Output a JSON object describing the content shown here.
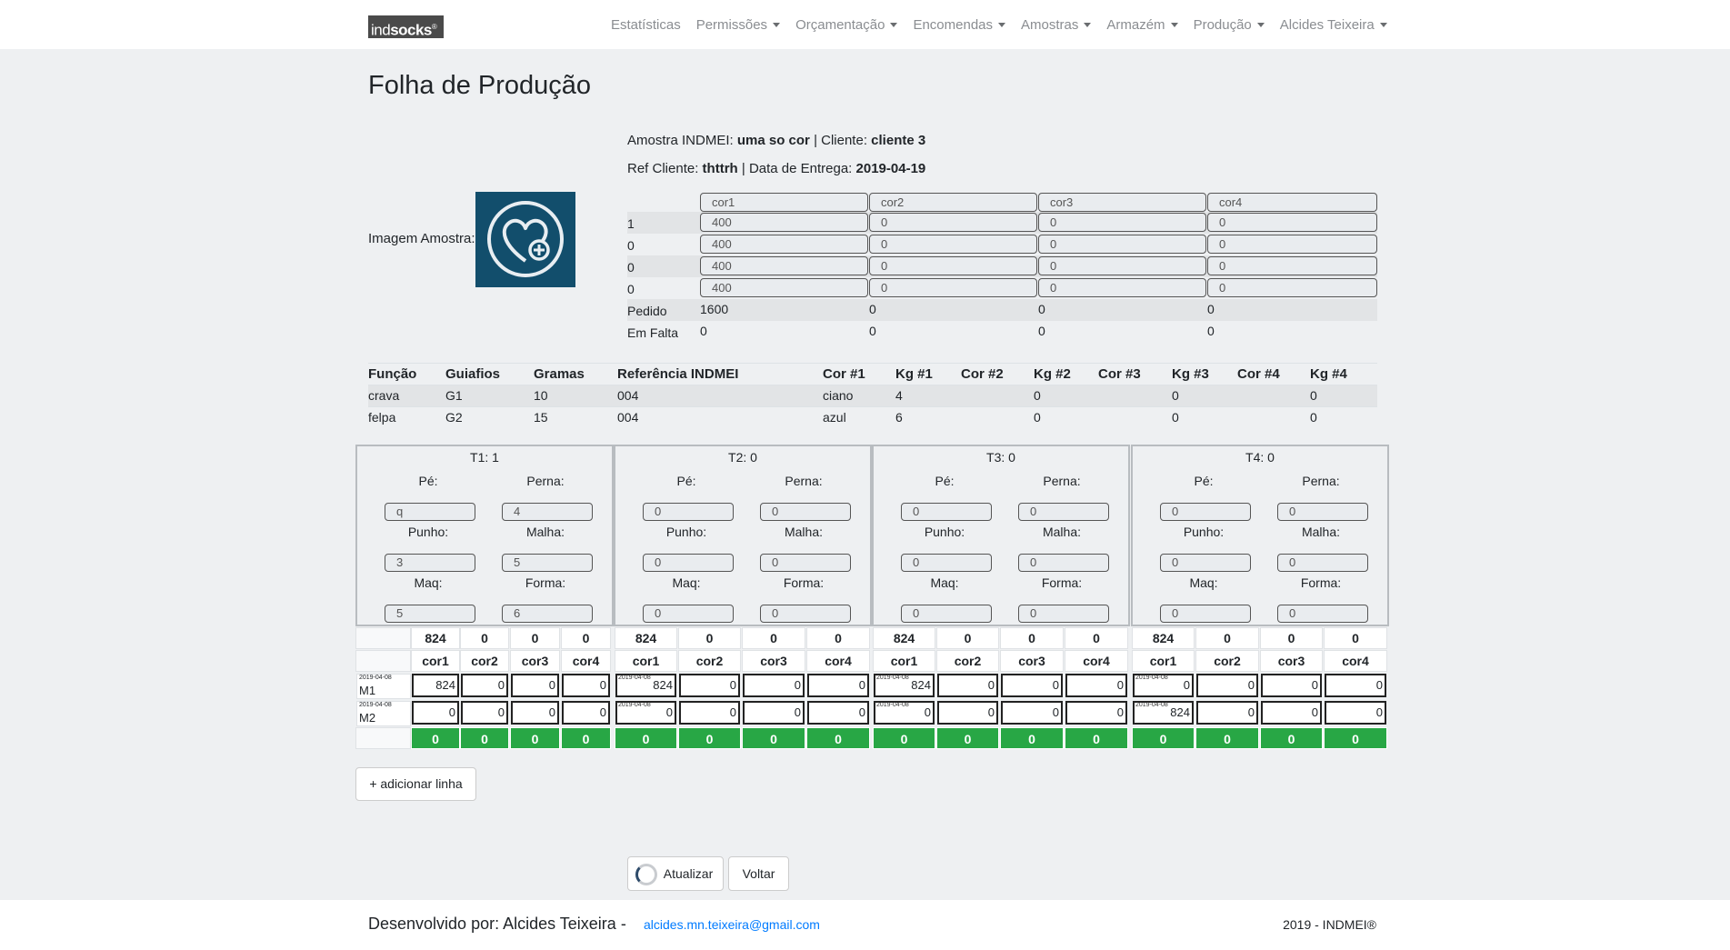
{
  "brand": {
    "prefix": "ind",
    "bold": "socks",
    "mark": "®"
  },
  "nav": {
    "items": [
      {
        "label": "Estatísticas",
        "dropdown": false
      },
      {
        "label": "Permissões",
        "dropdown": true
      },
      {
        "label": "Orçamentação",
        "dropdown": true
      },
      {
        "label": "Encomendas",
        "dropdown": true
      },
      {
        "label": "Amostras",
        "dropdown": true
      },
      {
        "label": "Armazém",
        "dropdown": true
      },
      {
        "label": "Produção",
        "dropdown": true
      },
      {
        "label": "Alcides Teixeira",
        "dropdown": true
      }
    ]
  },
  "page": {
    "title": "Folha de Produção"
  },
  "sample": {
    "amostra_label": "Amostra INDMEI:",
    "amostra_value": "uma so cor",
    "cliente_label": "| Cliente:",
    "cliente_value": "cliente 3",
    "ref_label": "Ref Cliente:",
    "ref_value": "thttrh",
    "data_label": "| Data de Entrega:",
    "data_value": "2019-04-19",
    "image_label": "Imagem Amostra:",
    "image_icon": "heart-plus-icon"
  },
  "colors_table": {
    "headers": [
      "cor1",
      "cor2",
      "cor3",
      "cor4"
    ],
    "rows": [
      {
        "label": "1",
        "values": [
          "400",
          "0",
          "0",
          "0"
        ]
      },
      {
        "label": "0",
        "values": [
          "400",
          "0",
          "0",
          "0"
        ]
      },
      {
        "label": "0",
        "values": [
          "400",
          "0",
          "0",
          "0"
        ]
      },
      {
        "label": "0",
        "values": [
          "400",
          "0",
          "0",
          "0"
        ]
      }
    ],
    "pedido": {
      "label": "Pedido",
      "values": [
        "1600",
        "0",
        "0",
        "0"
      ]
    },
    "em_falta": {
      "label": "Em Falta",
      "values": [
        "0",
        "0",
        "0",
        "0"
      ]
    }
  },
  "function_table": {
    "headers": [
      "Função",
      "Guiafios",
      "Gramas",
      "Referência INDMEI",
      "Cor #1",
      "Kg #1",
      "Cor #2",
      "Kg #2",
      "Cor #3",
      "Kg #3",
      "Cor #4",
      "Kg #4"
    ],
    "rows": [
      [
        "crava",
        "G1",
        "10",
        "004",
        "ciano",
        "4",
        "",
        "0",
        "",
        "0",
        "",
        "0"
      ],
      [
        "felpa",
        "G2",
        "15",
        "004",
        "azul",
        "6",
        "",
        "0",
        "",
        "0",
        "",
        "0"
      ]
    ]
  },
  "panels": {
    "labels": {
      "pe": "Pé:",
      "perna": "Perna:",
      "punho": "Punho:",
      "malha": "Malha:",
      "maq": "Maq:",
      "forma": "Forma:"
    },
    "items": [
      {
        "title": "T1: 1",
        "pe": "q",
        "perna": "4",
        "punho": "3",
        "malha": "5",
        "maq": "5",
        "forma": "6"
      },
      {
        "title": "T2: 0",
        "pe": "0",
        "perna": "0",
        "punho": "0",
        "malha": "0",
        "maq": "0",
        "forma": "0"
      },
      {
        "title": "T3: 0",
        "pe": "0",
        "perna": "0",
        "punho": "0",
        "malha": "0",
        "maq": "0",
        "forma": "0"
      },
      {
        "title": "T4: 0",
        "pe": "0",
        "perna": "0",
        "punho": "0",
        "malha": "0",
        "maq": "0",
        "forma": "0"
      }
    ]
  },
  "grid": {
    "totals": [
      [
        "824",
        "0",
        "0",
        "0"
      ],
      [
        "824",
        "0",
        "0",
        "0"
      ],
      [
        "824",
        "0",
        "0",
        "0"
      ],
      [
        "824",
        "0",
        "0",
        "0"
      ]
    ],
    "color_headers": [
      "cor1",
      "cor2",
      "cor3",
      "cor4"
    ],
    "machines": [
      {
        "name": "M1",
        "date": "2019-04-08",
        "blocks": [
          {
            "date": "",
            "values": [
              "824",
              "0",
              "0",
              "0"
            ]
          },
          {
            "date": "2019-04-08",
            "values": [
              "824",
              "0",
              "0",
              "0"
            ]
          },
          {
            "date": "2019-04-08",
            "values": [
              "824",
              "0",
              "0",
              "0"
            ]
          },
          {
            "date": "2019-04-08",
            "values": [
              "0",
              "0",
              "0",
              "0"
            ]
          }
        ]
      },
      {
        "name": "M2",
        "date": "2019-04-08",
        "blocks": [
          {
            "date": "",
            "values": [
              "0",
              "0",
              "0",
              "0"
            ]
          },
          {
            "date": "2019-04-08",
            "values": [
              "0",
              "0",
              "0",
              "0"
            ]
          },
          {
            "date": "2019-04-08",
            "values": [
              "0",
              "0",
              "0",
              "0"
            ]
          },
          {
            "date": "2019-04-08",
            "values": [
              "824",
              "0",
              "0",
              "0"
            ]
          }
        ]
      }
    ],
    "balance": [
      [
        "0",
        "0",
        "0",
        "0"
      ],
      [
        "0",
        "0",
        "0",
        "0"
      ],
      [
        "0",
        "0",
        "0",
        "0"
      ],
      [
        "0",
        "0",
        "0",
        "0"
      ]
    ],
    "balance_color": "#28a745"
  },
  "buttons": {
    "add_line": "+ adicionar linha",
    "update": "Atualizar",
    "back": "Voltar"
  },
  "footer": {
    "developer": "Desenvolvido por: Alcides Teixeira -",
    "email": "alcides.mn.teixeira@gmail.com",
    "copyright": "2019 - INDMEI®"
  }
}
